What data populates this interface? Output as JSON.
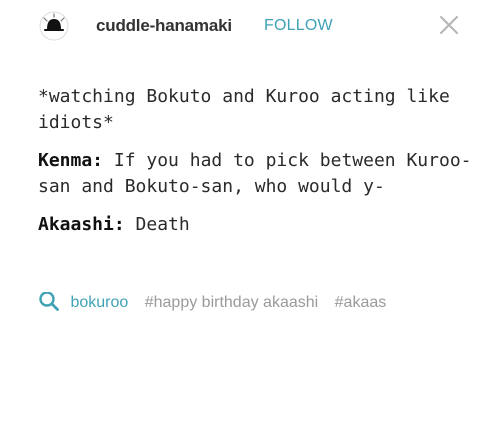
{
  "header": {
    "username": "cuddle-hanamaki",
    "follow_label": "FOLLOW",
    "avatar_icon": "blog-avatar-icon",
    "close_icon": "close-icon"
  },
  "post": {
    "lines": [
      {
        "speaker": "",
        "text": "*watching Bokuto and Kuroo acting like idiots*"
      },
      {
        "speaker": "Kenma:",
        "text": " If you had to pick between Kuroo-san and Bokuto-san, who would y-"
      },
      {
        "speaker": "Akaashi:",
        "text": " Death"
      }
    ]
  },
  "tags": {
    "icon": "search-icon",
    "items": [
      "bokuroo",
      "#happy birthday akaashi",
      "#akaas"
    ]
  },
  "colors": {
    "accent": "#3fa2b5",
    "tag_text": "#9a9a9a",
    "body_text": "#2a2a2a"
  }
}
